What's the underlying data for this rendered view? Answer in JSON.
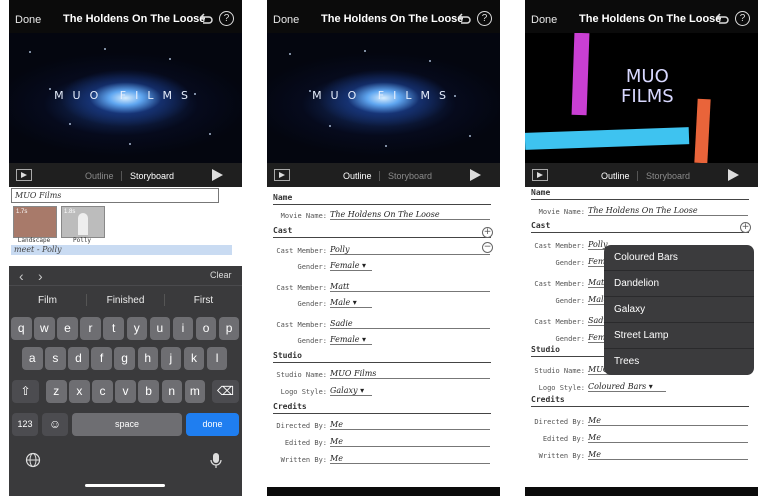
{
  "nav": {
    "done": "Done",
    "title": "The Holdens On The Loose"
  },
  "preview": {
    "logo_text": "MUO FILMS",
    "logo_line1": "MUO",
    "logo_line2": "FILMS"
  },
  "segment": {
    "outline": "Outline",
    "storyboard": "Storyboard"
  },
  "storyboard": {
    "company": "MUO Films",
    "cards": [
      {
        "label": "Landscape",
        "size": "1.7s"
      },
      {
        "label": "Polly",
        "size": "1.8s"
      }
    ],
    "highlight": "meet - Polly"
  },
  "keyboard": {
    "clear": "Clear",
    "suggestions": [
      "Film",
      "Finished",
      "First"
    ],
    "row1": [
      "q",
      "w",
      "e",
      "r",
      "t",
      "y",
      "u",
      "i",
      "o",
      "p"
    ],
    "row2": [
      "a",
      "s",
      "d",
      "f",
      "g",
      "h",
      "j",
      "k",
      "l"
    ],
    "row3": [
      "z",
      "x",
      "c",
      "v",
      "b",
      "n",
      "m"
    ],
    "num": "123",
    "space": "space",
    "done": "done"
  },
  "form": {
    "name_header": "Name",
    "movie_name_label": "Movie Name:",
    "movie_name": "The Holdens On The Loose",
    "cast_header": "Cast",
    "cast_member_label": "Cast Member:",
    "gender_label": "Gender:",
    "cast": [
      {
        "member": "Polly",
        "gender": "Female"
      },
      {
        "member": "Matt",
        "gender": "Male"
      },
      {
        "member": "Sadie",
        "gender": "Female"
      }
    ],
    "studio_header": "Studio",
    "studio_name_label": "Studio Name:",
    "studio_name": "MUO Films",
    "logo_style_label": "Logo Style:",
    "logo_style": "Galaxy",
    "logo_style_alt": "Coloured Bars",
    "credits_header": "Credits",
    "directed_label": "Directed By:",
    "directed": "Me",
    "edited_label": "Edited By:",
    "edited": "Me",
    "written_label": "Written By:",
    "written": "Me"
  },
  "logo_menu": [
    "Coloured Bars",
    "Dandelion",
    "Galaxy",
    "Street Lamp",
    "Trees"
  ],
  "colors": {
    "accent": "#1f7ef0",
    "bar_magenta": "#c93fd3",
    "bar_cyan": "#3ec3f0",
    "bar_orange": "#e9643a"
  }
}
